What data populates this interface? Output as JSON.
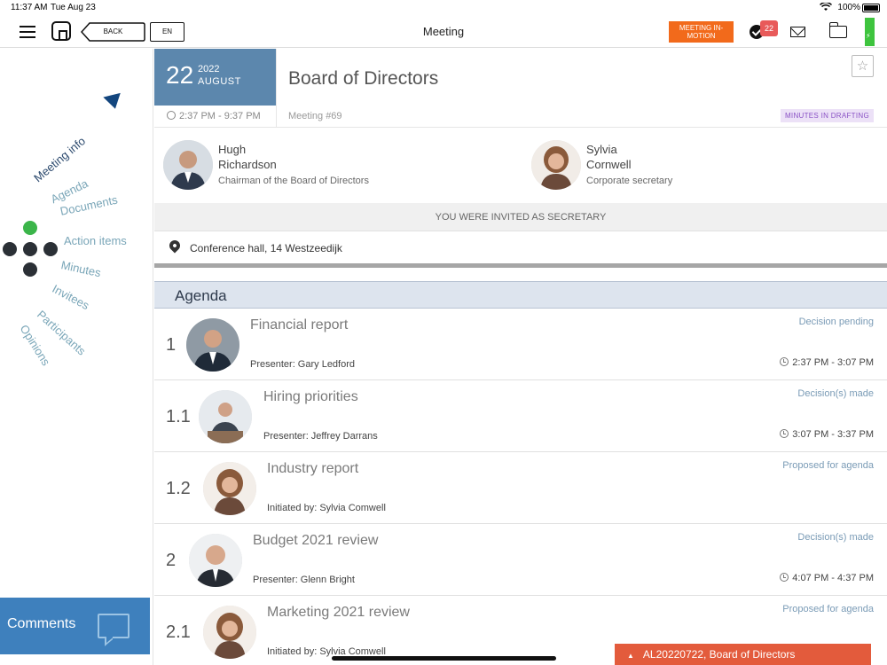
{
  "status_bar": {
    "time": "11:37 AM",
    "date": "Tue Aug 23",
    "battery": "100%"
  },
  "navbar": {
    "back_label": "BACK",
    "lang_label": "EN",
    "title": "Meeting",
    "meeting_in_motion_label": "MEETING IN-MOTION",
    "notification_count": "22"
  },
  "sidebar": {
    "items": [
      {
        "label": "Meeting info",
        "active": true
      },
      {
        "label": "Agenda"
      },
      {
        "label": "Documents"
      },
      {
        "label": "Action items"
      },
      {
        "label": "Minutes"
      },
      {
        "label": "Invitees"
      },
      {
        "label": "Participants"
      },
      {
        "label": "Opinions"
      }
    ],
    "comments_label": "Comments"
  },
  "meeting": {
    "day": "22",
    "year": "2022",
    "month": "AUGUST",
    "title": "Board of Directors",
    "time_range": "2:37 PM - 9:37 PM",
    "meeting_no": "Meeting #69",
    "status": "MINUTES IN DRAFTING",
    "chairman": {
      "first": "Hugh",
      "last": "Richardson",
      "role": "Chairman of the Board of Directors"
    },
    "secretary": {
      "first": "Sylvia",
      "last": "Cornwell",
      "role": "Corporate secretary"
    },
    "invited_text": "YOU WERE INVITED AS SECRETARY",
    "location": "Conference hall, 14 Westzeedijk"
  },
  "agenda": {
    "header": "Agenda",
    "items": [
      {
        "num": "1",
        "title": "Financial report",
        "presenter": "Presenter: Gary Ledford",
        "status": "Decision pending",
        "time": "2:37 PM - 3:07 PM"
      },
      {
        "num": "1.1",
        "title": "Hiring priorities",
        "presenter": "Presenter: Jeffrey Darrans",
        "status": "Decision(s) made",
        "time": "3:07 PM - 3:37 PM"
      },
      {
        "num": "1.2",
        "title": "Industry report",
        "presenter": "Initiated by: Sylvia Comwell",
        "status": "Proposed for agenda",
        "time": ""
      },
      {
        "num": "2",
        "title": "Budget 2021 review",
        "presenter": "Presenter: Glenn Bright",
        "status": "Decision(s) made",
        "time": "4:07 PM - 4:37 PM"
      },
      {
        "num": "2.1",
        "title": "Marketing 2021 review",
        "presenter": "Initiated by: Sylvia Comwell",
        "status": "Proposed for agenda",
        "time": ""
      }
    ]
  },
  "bottom_bar": {
    "label": "AL20220722, Board of Directors"
  },
  "colors": {
    "date_box": "#5c87ad",
    "meeting_in_motion": "#f26a1b",
    "badge": "#e85a5a",
    "comments": "#3e80bd",
    "bottom_bar": "#e35b3c",
    "status_chip_bg": "#ece1f7",
    "status_chip_text": "#8a52c5"
  }
}
